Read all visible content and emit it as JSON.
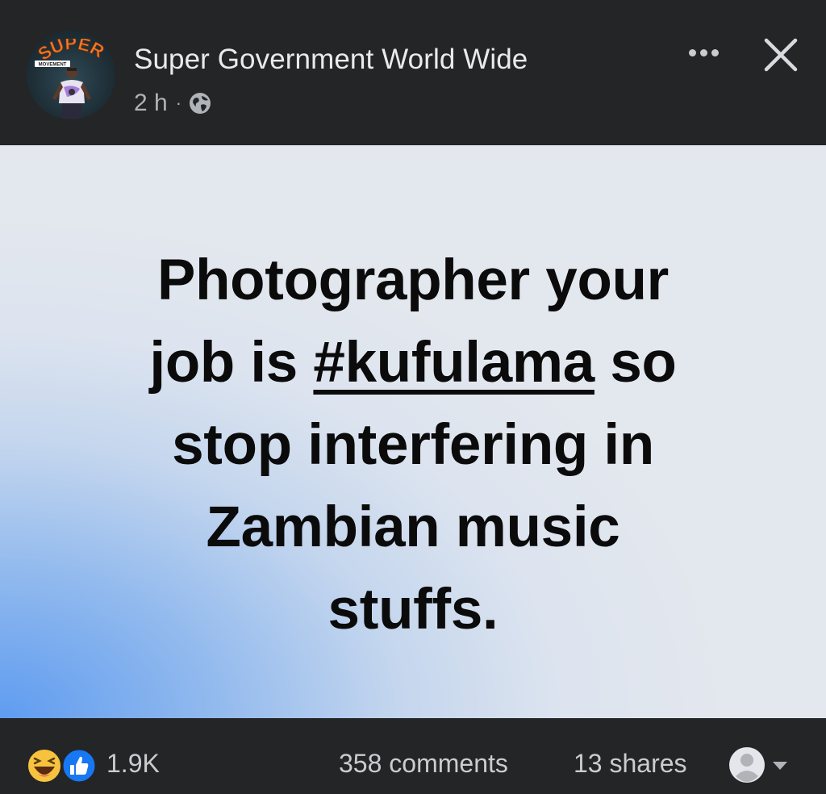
{
  "header": {
    "page_name": "Super Government World Wide",
    "time_ago": "2 h",
    "separator": "·",
    "privacy_icon": "globe-icon",
    "avatar_logo_text": "SUPER",
    "avatar_logo_subtext": "MOVEMENT",
    "more_icon": "more-horizontal-icon",
    "close_icon": "close-icon"
  },
  "post": {
    "line1": "Photographer your",
    "line2_before": "job is ",
    "hashtag": "#kufulama",
    "line2_after": " so",
    "line3": "stop interfering in",
    "line4": "Zambian music",
    "line5": "stuffs."
  },
  "footer": {
    "reaction_icons": [
      "haha-reaction-icon",
      "like-reaction-icon"
    ],
    "reaction_count": "1.9K",
    "comments": "358 comments",
    "shares": "13 shares",
    "viewer_icon": "profile-avatar-icon"
  },
  "colors": {
    "background": "#242526",
    "text_primary": "#e9eaee",
    "text_secondary": "#b0b3b8",
    "like_blue": "#1877f2",
    "haha_yellow": "#f7c33f",
    "gradient_blue": "#5f9cf0",
    "gradient_light": "#e3e7ee"
  }
}
